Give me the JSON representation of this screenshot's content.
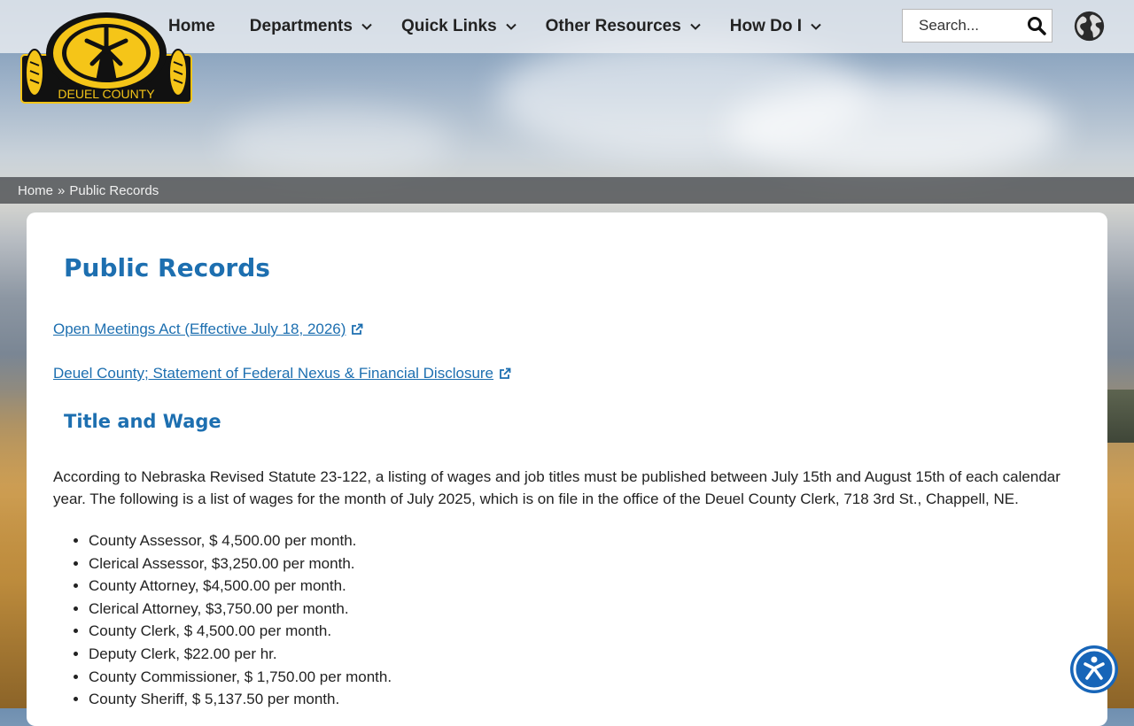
{
  "header": {
    "logo_text": "DEUEL COUNTY",
    "nav": [
      {
        "label": "Home",
        "has_dropdown": false
      },
      {
        "label": "Departments",
        "has_dropdown": true
      },
      {
        "label": "Quick Links",
        "has_dropdown": true
      },
      {
        "label": "Other Resources",
        "has_dropdown": true
      },
      {
        "label": "How Do I",
        "has_dropdown": true
      }
    ],
    "search": {
      "placeholder": "Search...",
      "icon": "search-icon"
    },
    "language_icon": "globe-icon"
  },
  "breadcrumb": {
    "home": "Home",
    "separator": "»",
    "current": "Public Records"
  },
  "main": {
    "title": "Public Records",
    "links": [
      {
        "label": "Open Meetings Act (Effective July 18, 2026)",
        "icon": "external-link-icon"
      },
      {
        "label": "Deuel County; Statement of Federal Nexus & Financial Disclosure",
        "icon": "external-link-icon"
      }
    ],
    "section_title": "Title and Wage",
    "intro": "According to Nebraska Revised Statute 23-122, a listing of wages and job titles must be published between July 15th and August 15th of each calendar year. The following is a list of wages for the month of July 2025, which is on file in the office of the Deuel County Clerk, 718 3rd St., Chappell, NE.",
    "wages": [
      "County Assessor, $ 4,500.00 per month.",
      "Clerical Assessor, $3,250.00 per month.",
      "County Attorney, $4,500.00 per month.",
      "Clerical Attorney, $3,750.00 per month.",
      "County Clerk, $ 4,500.00 per month.",
      "Deputy Clerk, $22.00 per hr.",
      "County Commissioner, $ 1,750.00 per month.",
      "County Sheriff, $ 5,137.50 per month."
    ]
  },
  "accessibility_icon": "accessibility-icon",
  "colors": {
    "accent": "#1d6fb0",
    "logo_gold": "#f5c518",
    "logo_black": "#111111"
  }
}
